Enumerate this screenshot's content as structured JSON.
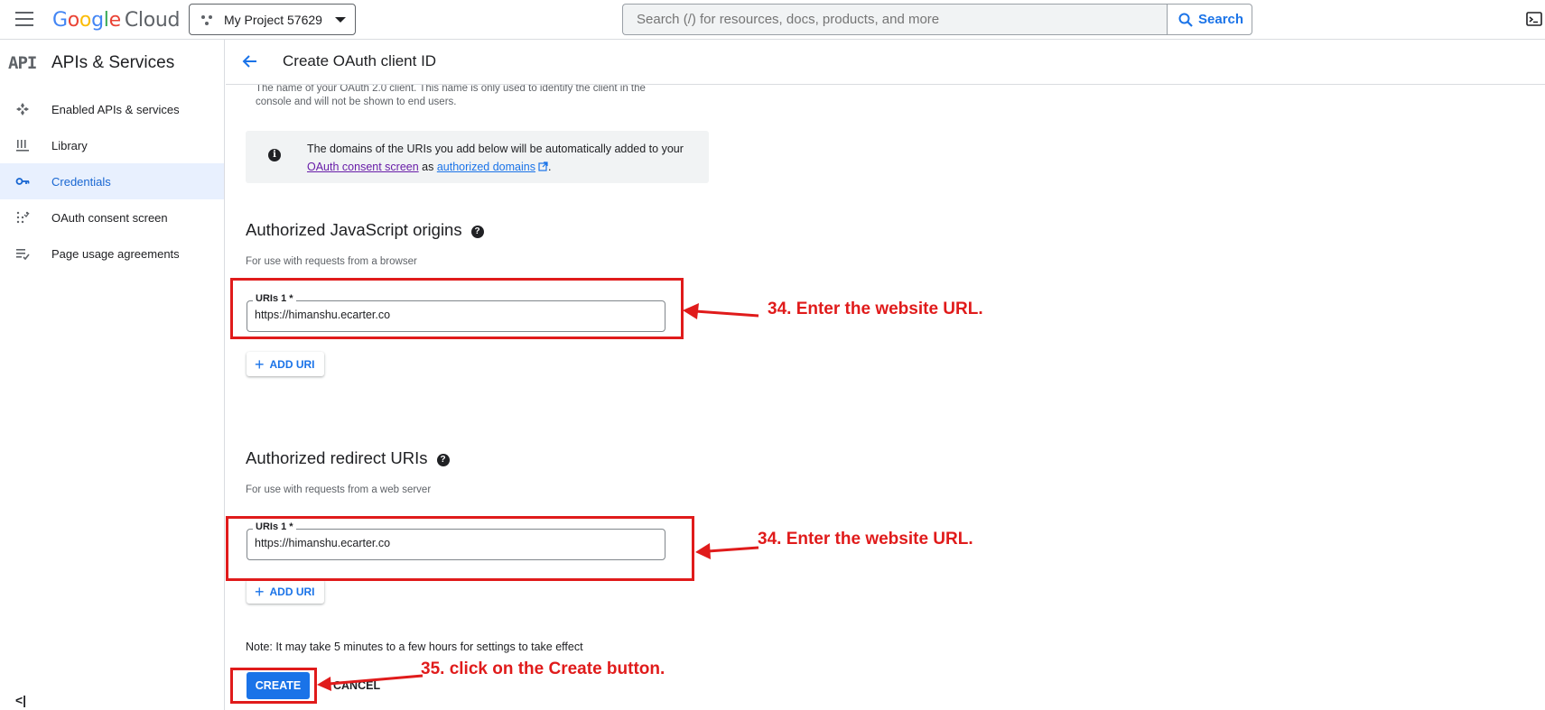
{
  "header": {
    "logo_google": "Google",
    "logo_cloud": "Cloud",
    "project_name": "My Project 57629",
    "search_placeholder": "Search (/) for resources, docs, products, and more",
    "search_button": "Search"
  },
  "sidebar": {
    "badge": "API",
    "title": "APIs & Services",
    "items": [
      {
        "label": "Enabled APIs & services",
        "icon": "enabled-apis-icon"
      },
      {
        "label": "Library",
        "icon": "library-icon"
      },
      {
        "label": "Credentials",
        "icon": "key-icon",
        "active": true
      },
      {
        "label": "OAuth consent screen",
        "icon": "oauth-consent-icon"
      },
      {
        "label": "Page usage agreements",
        "icon": "agreements-icon"
      }
    ],
    "collapse_glyph": "<|"
  },
  "page": {
    "title": "Create OAuth client ID",
    "helper_text": "The name of your OAuth 2.0 client. This name is only used to identify the client in the console and will not be shown to end users.",
    "info": {
      "text_before": "The domains of the URIs you add below will be automatically added to your ",
      "link1": "OAuth consent screen",
      "text_between": " as ",
      "link2": "authorized domains",
      "text_after": "."
    },
    "js_origins": {
      "title": "Authorized JavaScript origins",
      "subtitle": "For use with requests from a browser",
      "field_label": "URIs 1 *",
      "field_value": "https://himanshu.ecarter.co",
      "add_button": "ADD URI"
    },
    "redirect_uris": {
      "title": "Authorized redirect URIs",
      "subtitle": "For use with requests from a web server",
      "field_label": "URIs 1 *",
      "field_value": "https://himanshu.ecarter.co",
      "add_button": "ADD URI"
    },
    "note": "Note: It may take 5 minutes to a few hours for settings to take effect",
    "create_button": "CREATE",
    "cancel_button": "CANCEL"
  },
  "annotations": {
    "step34a": "34. Enter the website URL.",
    "step34b": "34. Enter the website URL.",
    "step35": "35. click on the Create button.",
    "color": "#e01b1b"
  }
}
